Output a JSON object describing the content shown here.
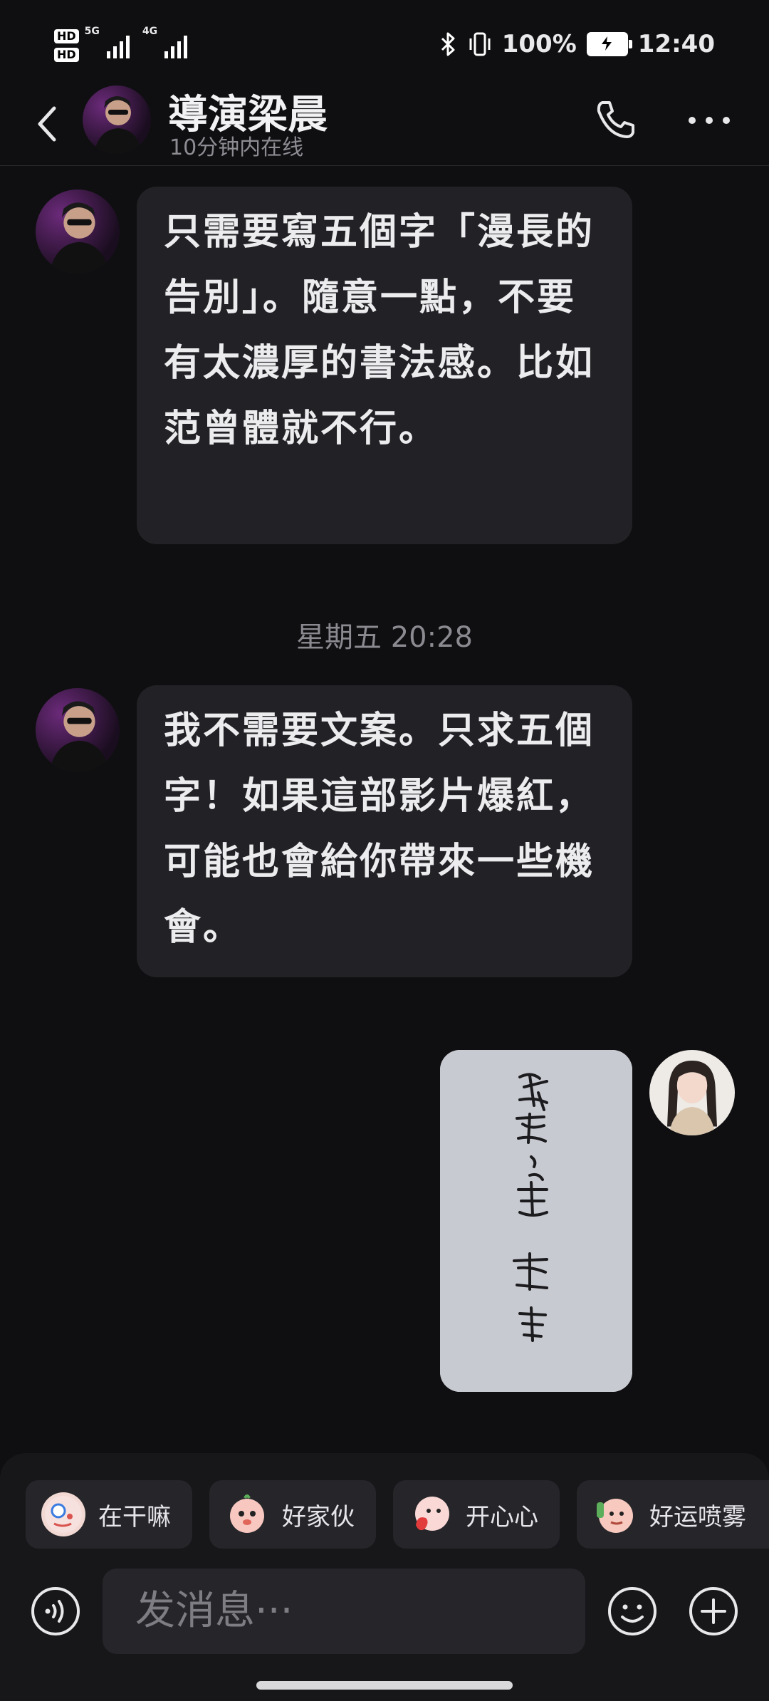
{
  "status_bar": {
    "hd1": "HD",
    "hd2": "HD",
    "net_left": "5G",
    "net_right": "4G",
    "battery_pct": "100%",
    "time": "12:40"
  },
  "header": {
    "contact_name": "導演梁晨",
    "online_status": "10分钟内在线"
  },
  "messages": [
    {
      "sender": "contact",
      "text": "只需要寫五個字「漫長的告別」。隨意一點，不要有太濃厚的書法感。比如范曾體就不行。"
    },
    {
      "sender": "contact",
      "text": "我不需要文案。只求五個字！如果這部影片爆紅，可能也會給你帶來一些機會。"
    }
  ],
  "timestamp": "星期五 20:28",
  "quick_replies": [
    {
      "label": "在干嘛"
    },
    {
      "label": "好家伙"
    },
    {
      "label": "开心心"
    },
    {
      "label": "好运喷雾"
    }
  ],
  "composer": {
    "placeholder": "发消息···"
  },
  "colors": {
    "background": "#0f0f11",
    "bubble": "#222226",
    "panel": "#17171a",
    "accent": "#e9e9ec"
  },
  "icons": [
    "back-arrow-icon",
    "phone-icon",
    "more-icon",
    "voice-icon",
    "emoji-icon",
    "plus-icon"
  ]
}
